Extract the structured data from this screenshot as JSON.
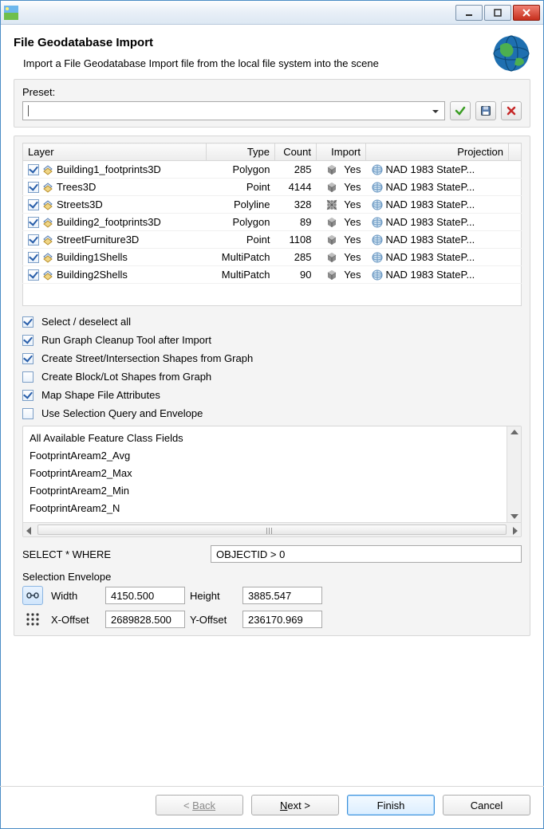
{
  "window_title": "",
  "page_title": "File Geodatabase Import",
  "description": "Import a File Geodatabase Import file from the local file system into the scene",
  "preset": {
    "label": "Preset:",
    "value": ""
  },
  "buttons": {
    "apply_preset": "apply",
    "save_preset": "save",
    "delete_preset": "delete"
  },
  "table": {
    "headers": {
      "layer": "Layer",
      "type": "Type",
      "count": "Count",
      "import": "Import",
      "projection": "Projection"
    },
    "rows": [
      {
        "checked": true,
        "layer": "Building1_footprints3D",
        "type": "Polygon",
        "count": "285",
        "import": "Yes",
        "projection": "NAD 1983 StateP...",
        "importIcon": "cube"
      },
      {
        "checked": true,
        "layer": "Trees3D",
        "type": "Point",
        "count": "4144",
        "import": "Yes",
        "projection": "NAD 1983 StateP...",
        "importIcon": "cube"
      },
      {
        "checked": true,
        "layer": "Streets3D",
        "type": "Polyline",
        "count": "328",
        "import": "Yes",
        "projection": "NAD 1983 StateP...",
        "importIcon": "hatch"
      },
      {
        "checked": true,
        "layer": "Building2_footprints3D",
        "type": "Polygon",
        "count": "89",
        "import": "Yes",
        "projection": "NAD 1983 StateP...",
        "importIcon": "cube"
      },
      {
        "checked": true,
        "layer": "StreetFurniture3D",
        "type": "Point",
        "count": "1108",
        "import": "Yes",
        "projection": "NAD 1983 StateP...",
        "importIcon": "cube"
      },
      {
        "checked": true,
        "layer": "Building1Shells",
        "type": "MultiPatch",
        "count": "285",
        "import": "Yes",
        "projection": "NAD 1983 StateP...",
        "importIcon": "cube"
      },
      {
        "checked": true,
        "layer": "Building2Shells",
        "type": "MultiPatch",
        "count": "90",
        "import": "Yes",
        "projection": "NAD 1983 StateP...",
        "importIcon": "cube"
      }
    ]
  },
  "options": [
    {
      "checked": true,
      "label": "Select / deselect all"
    },
    {
      "checked": true,
      "label": "Run Graph Cleanup Tool after Import"
    },
    {
      "checked": true,
      "label": "Create Street/Intersection Shapes from Graph"
    },
    {
      "checked": false,
      "label": "Create Block/Lot Shapes from Graph"
    },
    {
      "checked": true,
      "label": "Map Shape File Attributes"
    },
    {
      "checked": false,
      "label": "Use Selection Query and Envelope"
    }
  ],
  "fields_list": {
    "title": "All Available Feature Class Fields",
    "items": [
      "FootprintAream2_Avg",
      "FootprintAream2_Max",
      "FootprintAream2_Min",
      "FootprintAream2_N"
    ]
  },
  "where": {
    "label": "SELECT * WHERE",
    "value": "OBJECTID > 0"
  },
  "envelope": {
    "title": "Selection Envelope",
    "width_label": "Width",
    "width_value": "4150.500",
    "height_label": "Height",
    "height_value": "3885.547",
    "xoff_label": "X-Offset",
    "xoff_value": "2689828.500",
    "yoff_label": "Y-Offset",
    "yoff_value": "236170.969"
  },
  "wizard": {
    "back": "Back",
    "next": "Next >",
    "finish": "Finish",
    "cancel": "Cancel"
  }
}
